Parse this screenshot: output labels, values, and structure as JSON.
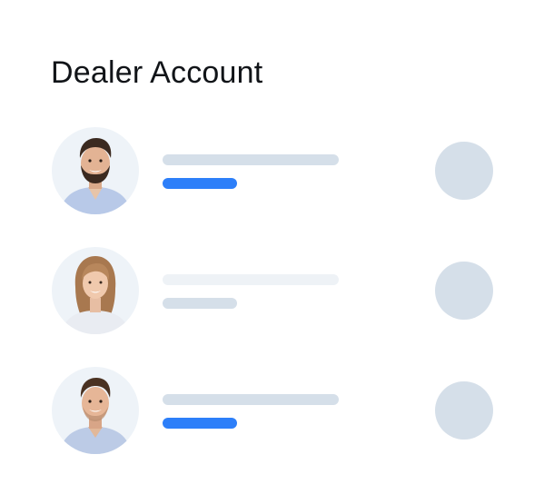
{
  "header": {
    "title": "Dealer Account"
  },
  "accounts": [
    {
      "avatar": "male-bearded-avatar",
      "name_bar_color": "#d5dfe9",
      "status_bar_color": "#2d7ff9",
      "action_dot_color": "#d5dfe9"
    },
    {
      "avatar": "female-blonde-avatar",
      "name_bar_color": "#eef2f6",
      "status_bar_color": "#d5dfe9",
      "action_dot_color": "#d5dfe9"
    },
    {
      "avatar": "male-short-hair-avatar",
      "name_bar_color": "#d5dfe9",
      "status_bar_color": "#2d7ff9",
      "action_dot_color": "#d5dfe9"
    }
  ],
  "colors": {
    "accent": "#2d7ff9",
    "placeholder": "#d5dfe9",
    "placeholder_light": "#eef2f6",
    "avatar_bg": "#eef3f8"
  }
}
